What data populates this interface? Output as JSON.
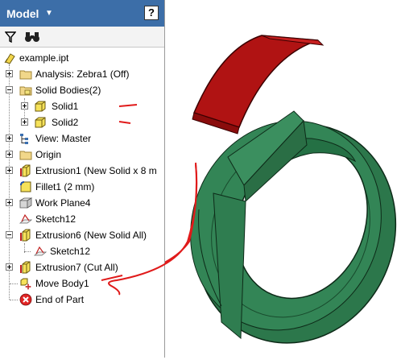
{
  "browser": {
    "title": "Model",
    "help_label": "?"
  },
  "toolbar": {
    "filter_icon": "filter-icon",
    "find_icon": "binoculars-icon"
  },
  "tree": {
    "items": [
      {
        "label": "example.ipt"
      },
      {
        "label": "Analysis: Zebra1 (Off)"
      },
      {
        "label": "Solid Bodies(2)"
      },
      {
        "label": "Solid1"
      },
      {
        "label": "Solid2"
      },
      {
        "label": "View: Master"
      },
      {
        "label": "Origin"
      },
      {
        "label": "Extrusion1 (New Solid x 8 m"
      },
      {
        "label": "Fillet1 (2 mm)"
      },
      {
        "label": "Work Plane4"
      },
      {
        "label": "Sketch12"
      },
      {
        "label": "Extrusion6 (New Solid All)"
      },
      {
        "label": "Sketch12"
      },
      {
        "label": "Extrusion7 (Cut All)"
      },
      {
        "label": "Move Body1"
      },
      {
        "label": "End of Part"
      }
    ]
  },
  "colors": {
    "title_bar": "#3c6ea8",
    "ring_green": "#2e7a4e",
    "cut_red": "#b01010",
    "annotation_red": "#e01a1a"
  }
}
